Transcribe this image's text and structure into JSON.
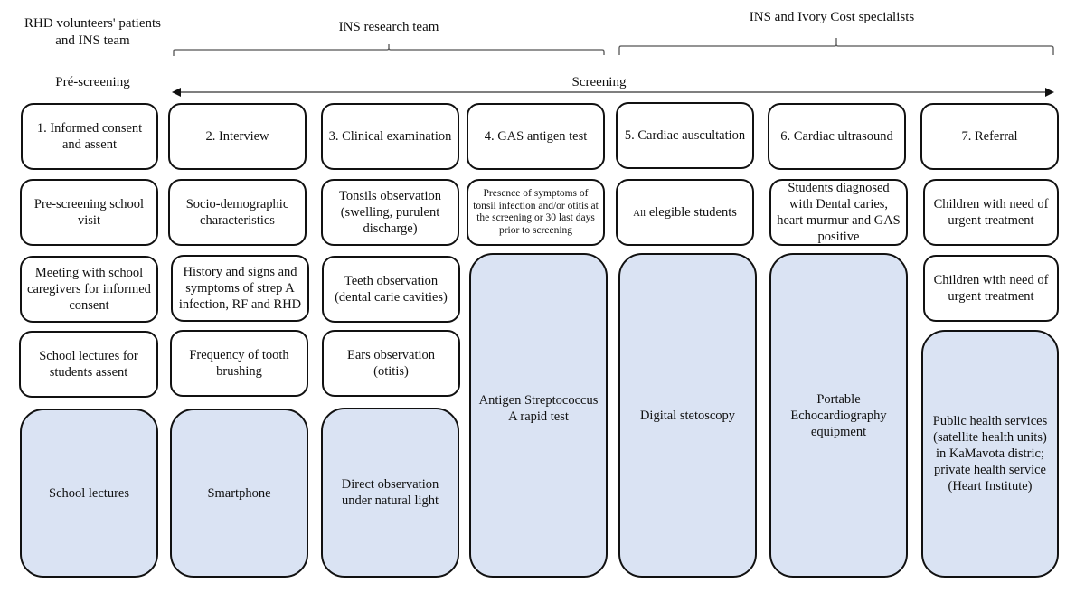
{
  "diagram": {
    "group_labels": {
      "left": "RHD volunteers' patients and INS team",
      "middle": "INS research team",
      "right": "INS and Ivory Cost specialists"
    },
    "phase_labels": {
      "prescreening": "Pré-screening",
      "screening": "Screening"
    },
    "colors": {
      "box_border": "#111111",
      "step_fill": "#ffffff",
      "tool_fill": "#dae3f3",
      "line": "#555555"
    },
    "columns": [
      {
        "step": "1. Informed consent and assent",
        "items": [
          "Pre-screening school  visit",
          "Meeting with school caregivers for informed consent",
          "School lectures for students assent"
        ],
        "tool": "School lectures"
      },
      {
        "step": "2. Interview",
        "items": [
          "Socio-demographic characteristics",
          "History and signs and symptoms of strep A infection, RF and RHD",
          "Frequency of tooth brushing"
        ],
        "tool": "Smartphone"
      },
      {
        "step": "3. Clinical examination",
        "items": [
          "Tonsils observation (swelling, purulent discharge)",
          "Teeth observation (dental carie cavities)",
          "Ears observation (otitis)"
        ],
        "tool": "Direct observation under natural light"
      },
      {
        "step": "4. GAS antigen test",
        "items": [
          "Presence of symptoms of tonsil infection  and/or otitis at the screening or 30 last days prior to screening"
        ],
        "tool": "Antigen Streptococcus A rapid test"
      },
      {
        "step": "5. Cardiac auscultation",
        "items_prefix": "All",
        "items": [
          " elegible students"
        ],
        "tool": "Digital stetoscopy"
      },
      {
        "step": "6. Cardiac ultrasound",
        "items": [
          "Students diagnosed with Dental caries, heart murmur and GAS positive"
        ],
        "tool": "Portable Echocardiography equipment"
      },
      {
        "step": "7. Referral",
        "items": [
          "Children with need of urgent treatment",
          "Children with need of urgent treatment"
        ],
        "tool": "Public health services (satellite health units) in KaMavota distric; private health service (Heart Institute)"
      }
    ]
  }
}
